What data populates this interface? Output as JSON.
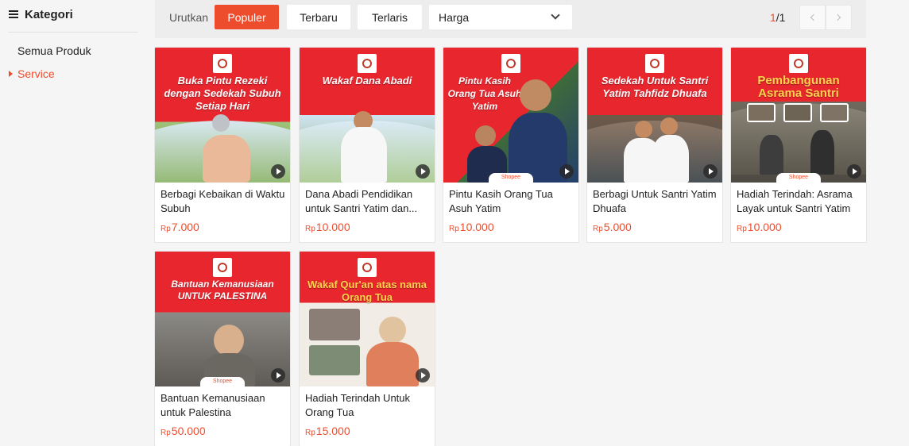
{
  "sidebar": {
    "title": "Kategori",
    "items": [
      {
        "label": "Semua Produk",
        "active": false
      },
      {
        "label": "Service",
        "active": true
      }
    ]
  },
  "sortbar": {
    "label": "Urutkan",
    "buttons": [
      {
        "label": "Populer",
        "active": true
      },
      {
        "label": "Terbaru",
        "active": false
      },
      {
        "label": "Terlaris",
        "active": false
      }
    ],
    "price_select": "Harga",
    "pager": {
      "current": "1",
      "total": "/1"
    }
  },
  "colors": {
    "accent": "#ee4d2d",
    "banner_red": "#e8262e"
  },
  "products": [
    {
      "headline": "Buka Pintu Rezeki dengan Sedekah Subuh Setiap Hari",
      "name": "Berbagi Kebaikan di Waktu Subuh",
      "currency": "Rp",
      "price": "7.000",
      "shopee": ""
    },
    {
      "headline": "Wakaf Dana Abadi",
      "name": "Dana Abadi Pendidikan untuk Santri Yatim dan...",
      "currency": "Rp",
      "price": "10.000",
      "shopee": ""
    },
    {
      "headline": "Pintu Kasih Orang Tua Asuh Yatim",
      "name": "Pintu Kasih Orang Tua Asuh Yatim",
      "currency": "Rp",
      "price": "10.000",
      "shopee": "Shopee"
    },
    {
      "headline": "Sedekah Untuk Santri Yatim Tahfidz Dhuafa",
      "name": "Berbagi Untuk Santri Yatim Dhuafa",
      "currency": "Rp",
      "price": "5.000",
      "shopee": ""
    },
    {
      "headline": "Pembangunan Asrama Santri",
      "name": "Hadiah Terindah: Asrama Layak untuk Santri Yatim",
      "currency": "Rp",
      "price": "10.000",
      "shopee": "Shopee"
    },
    {
      "headline": "Bantuan Kemanusiaan UNTUK PALESTINA",
      "name": "Bantuan Kemanusiaan untuk Palestina",
      "currency": "Rp",
      "price": "50.000",
      "shopee": "Shopee"
    },
    {
      "headline": "Wakaf Qur'an atas nama Orang Tua",
      "name": "Hadiah Terindah Untuk Orang Tua",
      "currency": "Rp",
      "price": "15.000",
      "shopee": ""
    }
  ]
}
